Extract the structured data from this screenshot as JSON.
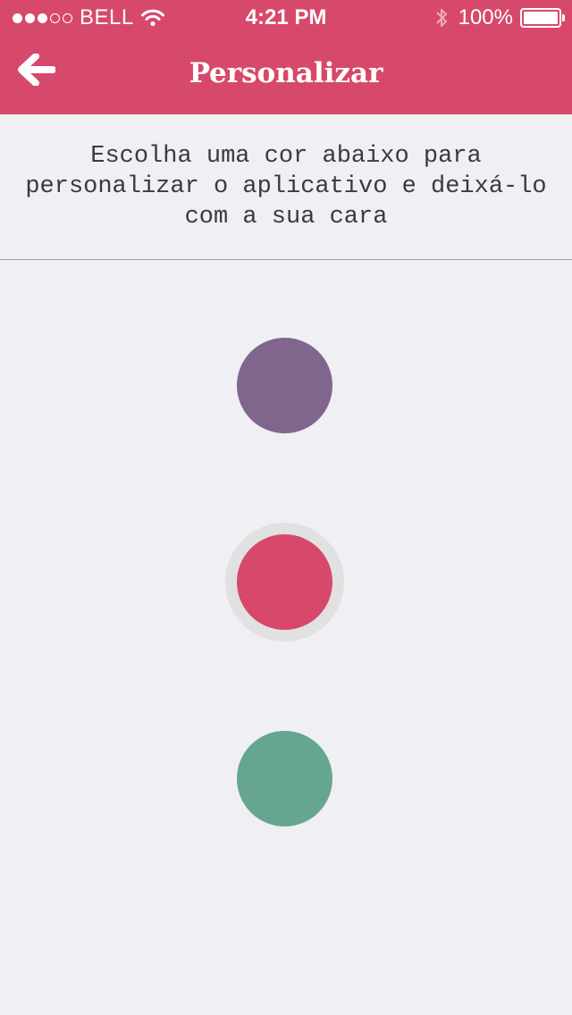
{
  "status_bar": {
    "carrier": "BELL",
    "time": "4:21 PM",
    "battery": "100%",
    "signal_bars_filled": 3,
    "signal_bars_total": 5,
    "icons": [
      "wifi-icon",
      "bluetooth-icon",
      "battery-icon"
    ]
  },
  "nav": {
    "title": "Personalizar",
    "back_icon": "arrow-left-icon"
  },
  "intro": {
    "text": "Escolha uma cor abaixo para personalizar o aplicativo e deixá-lo com a sua cara"
  },
  "colors": {
    "header": "#d6496b",
    "background": "#efeff4",
    "options": [
      {
        "color": "#80668c",
        "selected": false
      },
      {
        "color": "#d6496b",
        "selected": true
      },
      {
        "color": "#66a690",
        "selected": false
      }
    ]
  }
}
